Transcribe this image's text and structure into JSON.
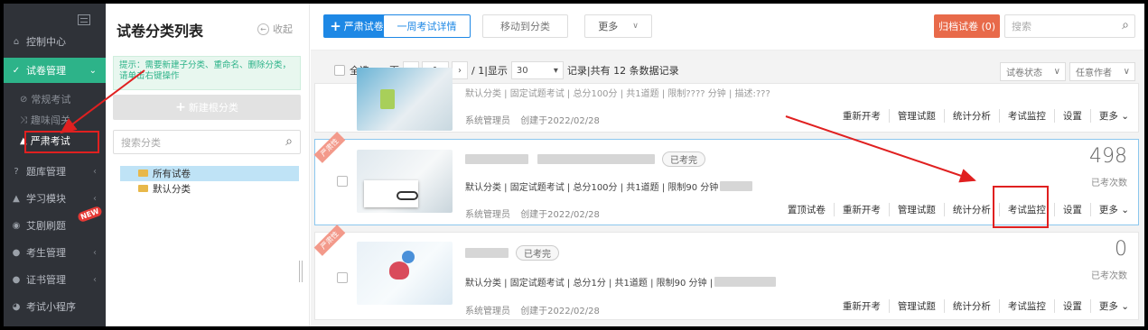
{
  "sidebar": {
    "items": [
      {
        "label": "控制中心",
        "icon": "home-icon",
        "glyph": "⌂"
      },
      {
        "label": "试卷管理",
        "icon": "check-circle-icon",
        "glyph": "✓"
      },
      {
        "label": "题库管理",
        "icon": "question-icon",
        "glyph": "?"
      },
      {
        "label": "学习模块",
        "icon": "graduation-cap-icon",
        "glyph": "▲"
      },
      {
        "label": "艾剧刷题",
        "icon": "target-icon",
        "glyph": "◉"
      },
      {
        "label": "考生管理",
        "icon": "user-icon",
        "glyph": "●"
      },
      {
        "label": "证书管理",
        "icon": "certificate-icon",
        "glyph": "●"
      },
      {
        "label": "考试小程序",
        "icon": "wechat-icon",
        "glyph": "◕"
      }
    ],
    "sub_items": [
      {
        "label": "常规考试",
        "glyph": "⊘"
      },
      {
        "label": "趣味闯关",
        "glyph": "⤨"
      },
      {
        "label": "严肃考试",
        "glyph": "▲"
      }
    ],
    "new_badge": "NEW",
    "active_color": "#2db389"
  },
  "category_panel": {
    "title": "试卷分类列表",
    "collapse_label": "收起",
    "tip": "提示：需要新建子分类、重命名、删除分类，请单击右键操作",
    "new_root_label": "新建根分类",
    "search_placeholder": "搜索分类",
    "tree": [
      {
        "label": "所有试卷"
      },
      {
        "label": "默认分类"
      }
    ]
  },
  "toolbar": {
    "strict_exam_label": "严肃试卷",
    "week_detail_label": "一周考试详情",
    "move_label": "移动到分类",
    "more_label": "更多",
    "archive_label": "归档试卷 (0)",
    "search_placeholder": "搜索",
    "primary_color": "#1e88e5",
    "archive_color": "#e86a4a"
  },
  "pager": {
    "select_all": "全选",
    "page_label": "页",
    "current_page": "1",
    "total_pages": "/ 1|显示",
    "page_size": "30",
    "record_text": "记录|共有 12 条数据记录",
    "status_filter": "试卷状态",
    "author_filter": "任意作者"
  },
  "cards": [
    {
      "meta": "默认分类 | 固定试题考试 | 总分100分 | 共1道题 | 限制???? 分钟 | 描述:???",
      "creator": "系统管理员",
      "created": "创建于2022/02/28",
      "actions": [
        "重新开考",
        "管理试题",
        "统计分析",
        "考试监控",
        "设置",
        "更多"
      ]
    },
    {
      "ribbon": "严肃性",
      "status": "已考完",
      "meta_a": "默认分类 | 固定试题考试 | 总分100分 | 共1道题 | 限制90 分钟",
      "creator": "系统管理员",
      "created": "创建于2022/02/28",
      "actions": [
        "置顶试卷",
        "重新开考",
        "管理试题",
        "统计分析",
        "考试监控",
        "设置",
        "更多"
      ],
      "count": "498",
      "count_label": "已考次数"
    },
    {
      "ribbon": "严肃性",
      "status": "已考完",
      "meta_a": "默认分类 | 固定试题考试 | 总分1分 | 共1道题 | 限制90 分钟 |",
      "creator": "系统管理员",
      "created": "创建于2022/02/28",
      "actions": [
        "重新开考",
        "管理试题",
        "统计分析",
        "考试监控",
        "设置",
        "更多"
      ],
      "count": "0",
      "count_label": "已考次数"
    }
  ],
  "annotation_color": "#e02020"
}
